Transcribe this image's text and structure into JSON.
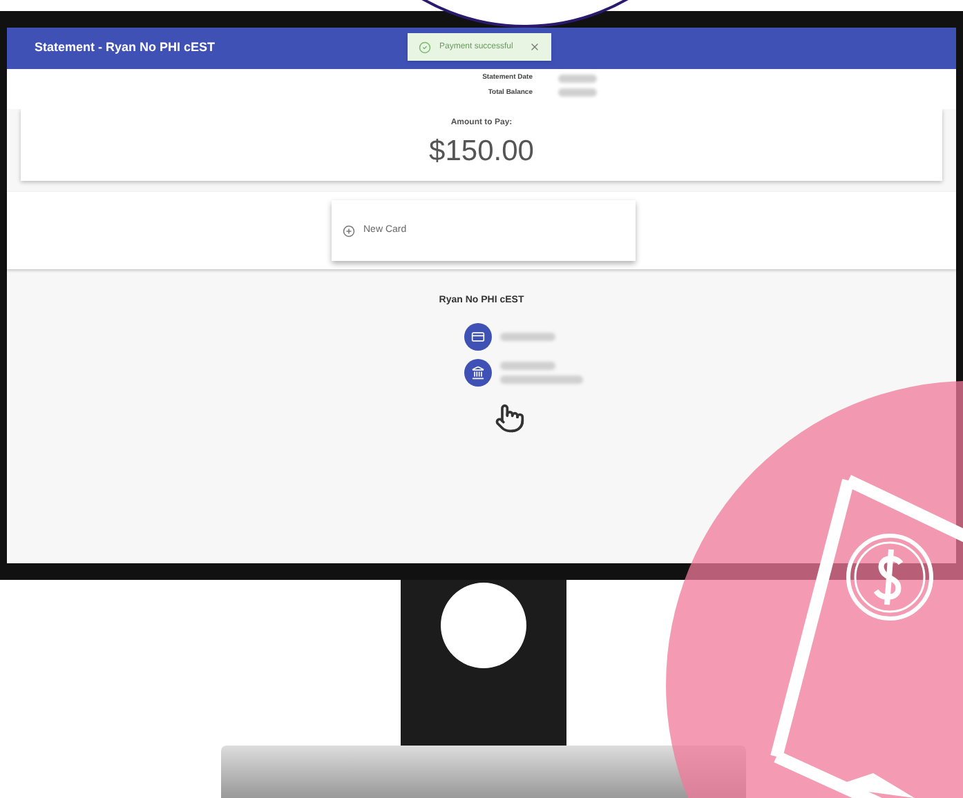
{
  "header": {
    "title": "Statement - Ryan No PHI cEST"
  },
  "toast": {
    "message": "Payment successful"
  },
  "summary": [
    {
      "label": "Statement Date"
    },
    {
      "label": "Total Balance"
    }
  ],
  "amount": {
    "label": "Amount to Pay:",
    "value": "$150.00"
  },
  "new_card": {
    "label": "New Card"
  },
  "payer": {
    "name": "Ryan No PHI cEST",
    "methods": [
      {
        "kind": "card"
      },
      {
        "kind": "bank"
      }
    ]
  }
}
